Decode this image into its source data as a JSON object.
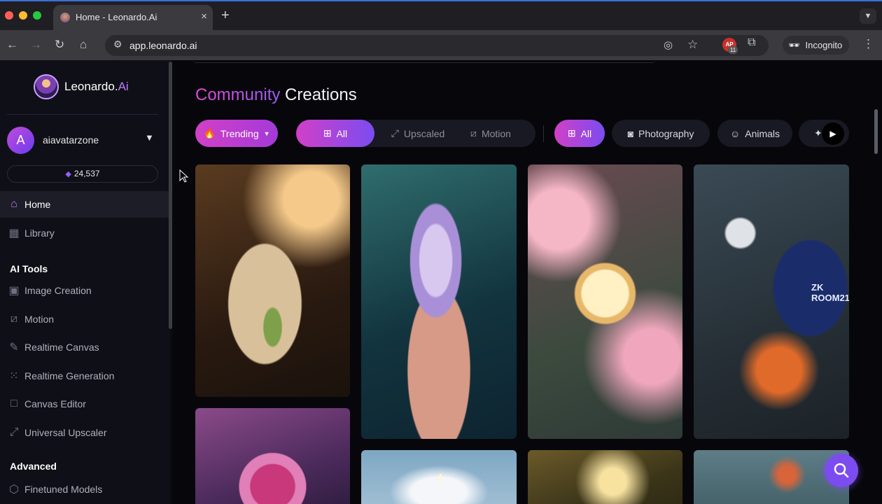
{
  "browser": {
    "tab_title": "Home - Leonardo.Ai",
    "tab_close": "×",
    "new_tab": "+",
    "url": "app.leonardo.ai",
    "ext_badge": "AP",
    "ext_count": "11",
    "incognito_label": "Incognito"
  },
  "sidebar": {
    "logo_text": "Leonardo.",
    "logo_accent": "Ai",
    "user": {
      "initial": "A",
      "name": "aiavatarzone"
    },
    "tokens": "24,537",
    "nav": [
      {
        "label": "Home",
        "icon": "home-icon"
      },
      {
        "label": "Library",
        "icon": "grid-icon"
      }
    ],
    "ai_tools_heading": "AI Tools",
    "ai_tools": [
      {
        "label": "Image Creation",
        "icon": "image-icon"
      },
      {
        "label": "Motion",
        "icon": "film-icon"
      },
      {
        "label": "Realtime Canvas",
        "icon": "brush-icon"
      },
      {
        "label": "Realtime Generation",
        "icon": "dots-icon"
      },
      {
        "label": "Canvas Editor",
        "icon": "frame-icon"
      },
      {
        "label": "Universal Upscaler",
        "icon": "upscale-icon"
      }
    ],
    "advanced_heading": "Advanced",
    "advanced": [
      {
        "label": "Finetuned Models",
        "icon": "cube-icon"
      }
    ]
  },
  "main": {
    "title_accent": "Community",
    "title_rest": " Creations",
    "filters": {
      "trending": "Trending",
      "type_all": "All",
      "upscaled": "Upscaled",
      "motion": "Motion",
      "category_all": "All",
      "photography": "Photography",
      "animals": "Animals"
    },
    "card_text": {
      "laptop_screen": "ZK ROOM21",
      "cross": "✝"
    }
  },
  "colors": {
    "accent_pink": "#d140c7",
    "accent_purple": "#7b4cf0",
    "sidebar_bg": "#0f1017",
    "main_bg": "#07070b"
  }
}
